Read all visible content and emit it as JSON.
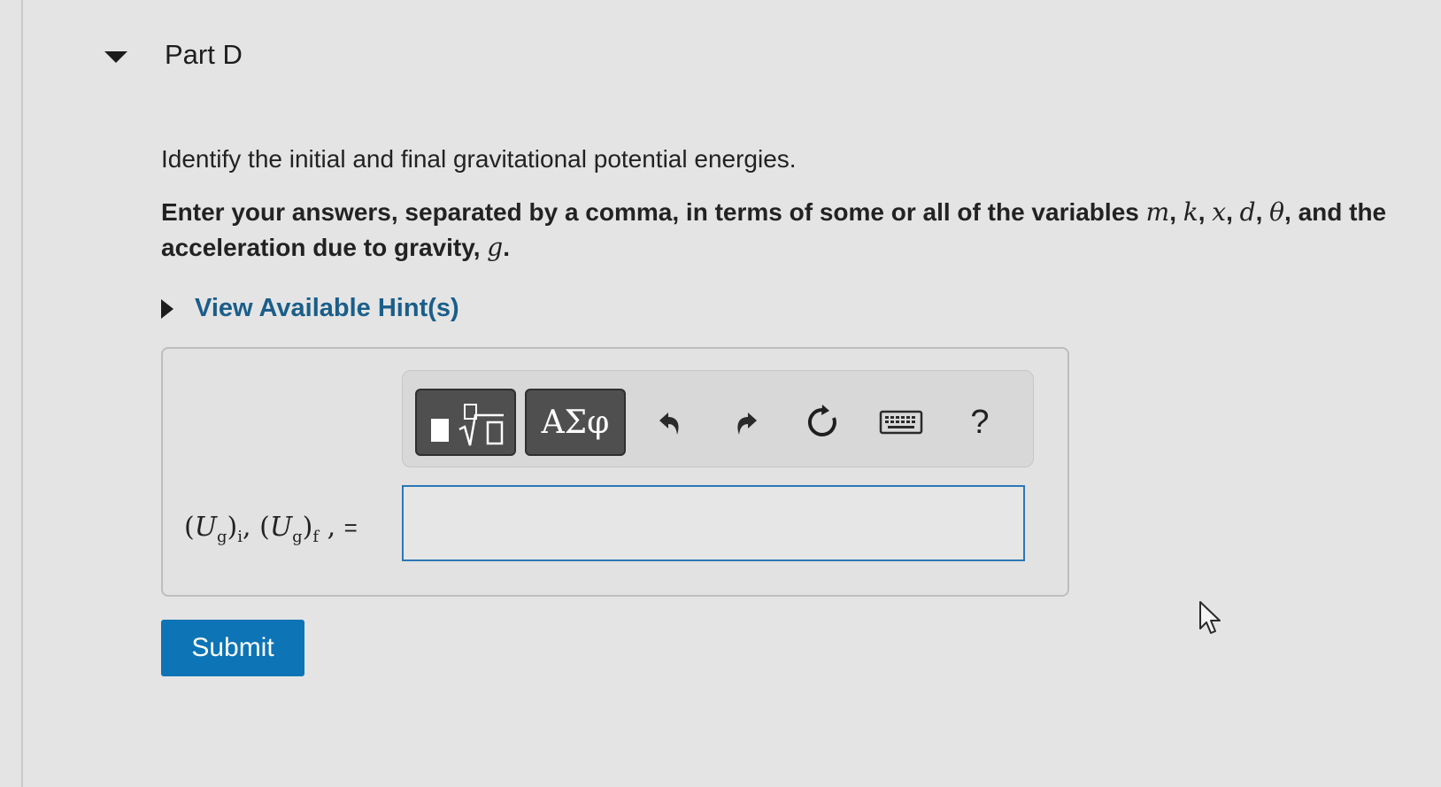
{
  "part": {
    "title": "Part D"
  },
  "question": {
    "prompt": "Identify the initial and final gravitational potential energies.",
    "instructions_text": "Enter your answers, separated by a comma, in terms of some or all of the variables",
    "variables": [
      "m",
      "k",
      "x",
      "d",
      "θ"
    ],
    "instructions_tail": "and the acceleration due to gravity,",
    "gravity_variable": "g"
  },
  "hints": {
    "label": "View Available Hint(s)"
  },
  "toolbar": {
    "templates_icon": "templates-sqrt-icon",
    "symbols_label": "ΑΣφ",
    "undo_icon": "undo-icon",
    "redo_icon": "redo-icon",
    "reset_icon": "reset-icon",
    "keyboard_icon": "keyboard-icon",
    "help_label": "?"
  },
  "answer": {
    "label_U": "U",
    "label_sub_g": "g",
    "label_sub_i": "i",
    "label_sub_f": "f",
    "equals": "=",
    "value": ""
  },
  "submit": {
    "label": "Submit"
  },
  "colors": {
    "accent": "#0d74b5",
    "link": "#1a5e8a",
    "input_border": "#2c77b6",
    "toolbar_button": "#4f4f4f"
  }
}
